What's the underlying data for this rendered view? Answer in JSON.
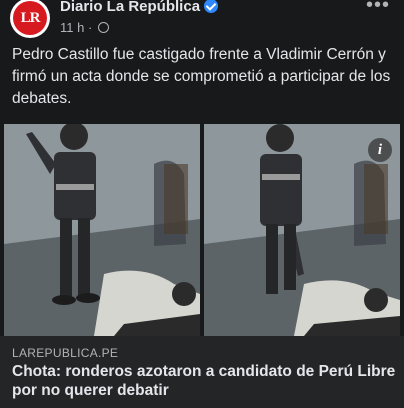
{
  "post": {
    "page_name": "Diario La República",
    "avatar_text": "LR",
    "time": "11 h",
    "separator": " · ",
    "more_label": "•••",
    "text": "Pedro Castillo fue castigado frente a Vladimir Cerrón y firmó un acta donde se comprometió a participar de los debates."
  },
  "media": {
    "info_label": "i"
  },
  "link": {
    "domain": "LAREPUBLICA.PE",
    "title": "Chota: ronderos azotaron a candidato de Perú Libre por no querer debatir"
  },
  "colors": {
    "background": "#18191a",
    "link_preview": "#242526",
    "verified": "#2d88ff",
    "brand": "#d71920"
  }
}
